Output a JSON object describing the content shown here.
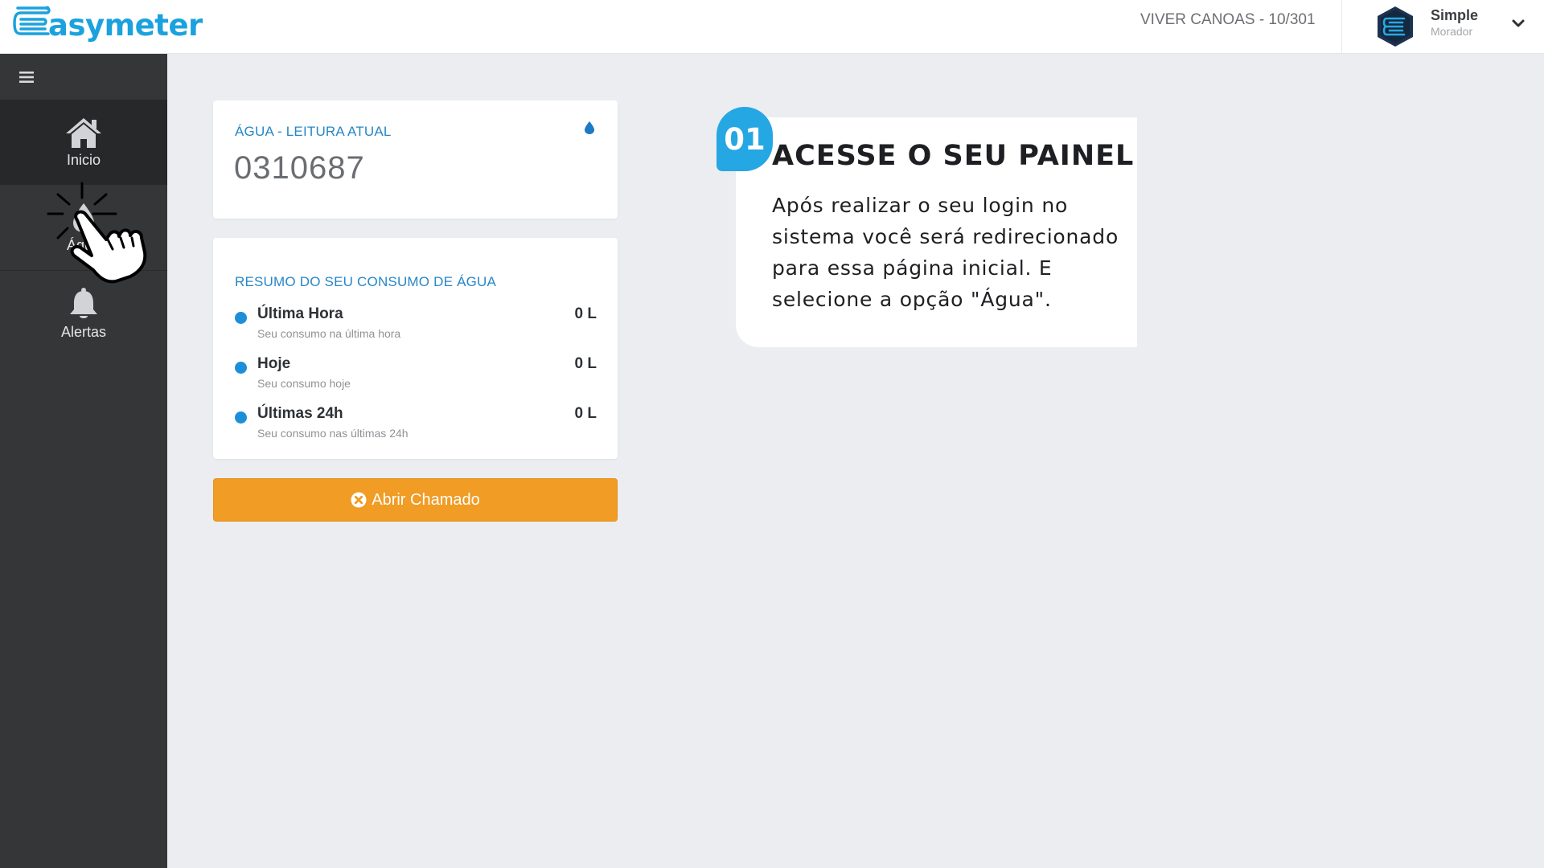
{
  "header": {
    "brand": "asymeter",
    "unit": "VIVER CANOAS - 10/301",
    "user": {
      "name": "Simple",
      "role": "Morador"
    }
  },
  "sidebar": {
    "items": [
      {
        "label": "Inicio",
        "icon": "home-icon",
        "active": true
      },
      {
        "label": "Água",
        "icon": "water-drop-icon",
        "active": false
      },
      {
        "label": "Alertas",
        "icon": "bell-icon",
        "active": false
      }
    ]
  },
  "reading_card": {
    "title": "ÁGUA - LEITURA ATUAL",
    "value": "0310687",
    "icon": "water-drop-icon"
  },
  "summary_card": {
    "title": "RESUMO DO SEU CONSUMO DE ÁGUA",
    "rows": [
      {
        "label": "Última Hora",
        "sub": "Seu consumo na última hora",
        "value": "0 L"
      },
      {
        "label": "Hoje",
        "sub": "Seu consumo hoje",
        "value": "0 L"
      },
      {
        "label": "Últimas 24h",
        "sub": "Seu consumo nas últimas 24h",
        "value": "0 L"
      }
    ]
  },
  "action": {
    "open_ticket_label": "Abrir Chamado"
  },
  "tutorial": {
    "step": "01",
    "title": "ACESSE O SEU PAINEL",
    "body": "Após realizar o seu login no sistema você será redirecionado para essa página inicial.  E selecione a opção \"Água\"."
  },
  "colors": {
    "brand_blue": "#1ba2de",
    "sidebar": "#353638",
    "accent_orange": "#f09c25",
    "badge_blue": "#25a7e3"
  }
}
